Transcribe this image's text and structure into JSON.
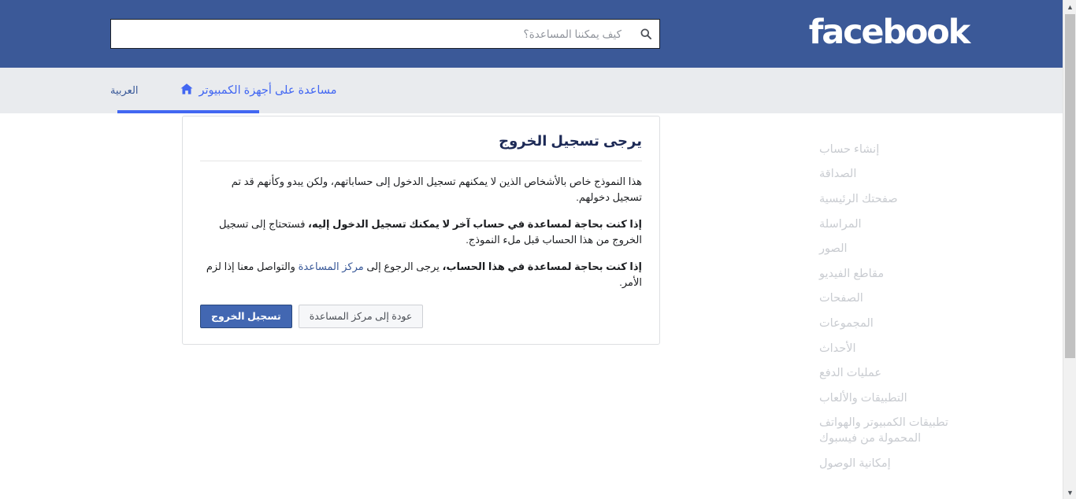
{
  "header": {
    "brand": "facebook",
    "brand_color": "#ffffff",
    "background_color": "#3b5998",
    "search": {
      "placeholder": "كيف يمكننا المساعدة؟",
      "value": "",
      "icon": "search-icon"
    }
  },
  "navbar": {
    "background_color": "#e9ebee",
    "active_tab": {
      "label": "مساعدة على أجهزة الكمبيوتر",
      "icon": "home-icon",
      "color": "#4267f2",
      "underline_color": "#4267f2"
    },
    "language": {
      "label": "العربية",
      "color": "#385898"
    }
  },
  "sidebar": {
    "items": [
      {
        "label": "إنشاء حساب"
      },
      {
        "label": "الصداقة"
      },
      {
        "label": "صفحتك الرئيسية"
      },
      {
        "label": "المراسلة"
      },
      {
        "label": "الصور"
      },
      {
        "label": "مقاطع الفيديو"
      },
      {
        "label": "الصفحات"
      },
      {
        "label": "المجموعات"
      },
      {
        "label": "الأحداث"
      },
      {
        "label": "عمليات الدفع"
      },
      {
        "label": "التطبيقات والألعاب"
      },
      {
        "label": "تطبيقات الكمبيوتر والهواتف المحمولة من فيسبوك"
      },
      {
        "label": "إمكانية الوصول"
      }
    ],
    "text_color": "#c9ccd1"
  },
  "card": {
    "title": "يرجى تسجيل الخروج",
    "paragraphs": [
      {
        "id": "intro",
        "segments": [
          {
            "text": "هذا النموذج خاص بالأشخاص الذين لا يمكنهم تسجيل الدخول إلى حساباتهم، ولكن يبدو وكأنهم قد تم تسجيل دخولهم.",
            "style": "normal"
          }
        ]
      },
      {
        "id": "other-account",
        "segments": [
          {
            "text": "إذا كنت بحاجة لمساعدة في حساب آخر لا يمكنك تسجيل الدخول إليه،",
            "style": "bold"
          },
          {
            "text": " فستحتاج إلى تسجيل الخروج من هذا الحساب قبل ملء النموذج.",
            "style": "normal"
          }
        ]
      },
      {
        "id": "this-account",
        "segments": [
          {
            "text": "إذا كنت بحاجة لمساعدة في هذا الحساب،",
            "style": "bold"
          },
          {
            "text": " يرجى الرجوع إلى ",
            "style": "normal"
          },
          {
            "text": "مركز المساعدة",
            "style": "link"
          },
          {
            "text": " والتواصل معنا إذا لزم الأمر.",
            "style": "normal"
          }
        ]
      }
    ],
    "buttons": {
      "primary": {
        "label": "تسجيل الخروج",
        "background": "#4267b2",
        "color": "#ffffff"
      },
      "secondary": {
        "label": "عودة إلى مركز المساعدة",
        "background": "#f6f7f9",
        "color": "#4b4f56"
      }
    },
    "border_color": "#dddfe2"
  },
  "scrollbar": {
    "up_arrow": "▲",
    "down_arrow": "▼",
    "thumb_color": "#c1c1c1"
  }
}
